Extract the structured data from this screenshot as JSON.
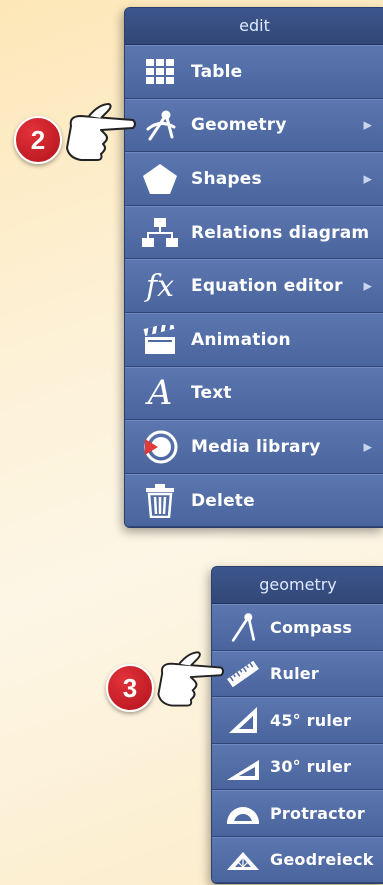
{
  "edit_menu": {
    "title": "edit",
    "items": [
      {
        "label": "Table",
        "icon": "table-icon",
        "submenu": false
      },
      {
        "label": "Geometry",
        "icon": "compass-icon",
        "submenu": true
      },
      {
        "label": "Shapes",
        "icon": "pentagon-icon",
        "submenu": true
      },
      {
        "label": "Relations diagram",
        "icon": "org-chart-icon",
        "submenu": false
      },
      {
        "label": "Equation editor",
        "icon": "fx-icon",
        "submenu": true
      },
      {
        "label": "Animation",
        "icon": "clapperboard-icon",
        "submenu": false
      },
      {
        "label": "Text",
        "icon": "letter-a-icon",
        "submenu": false
      },
      {
        "label": "Media library",
        "icon": "media-library-icon",
        "submenu": true
      },
      {
        "label": "Delete",
        "icon": "trash-icon",
        "submenu": false
      }
    ]
  },
  "geometry_menu": {
    "title": "geometry",
    "items": [
      {
        "label": "Compass",
        "icon": "compass-icon"
      },
      {
        "label": "Ruler",
        "icon": "ruler-icon"
      },
      {
        "label": "45° ruler",
        "icon": "set-square-45-icon"
      },
      {
        "label": "30° ruler",
        "icon": "set-square-30-icon"
      },
      {
        "label": "Protractor",
        "icon": "protractor-icon"
      },
      {
        "label": "Geodreieck",
        "icon": "geodreieck-icon"
      }
    ]
  },
  "callouts": {
    "step_2": "2",
    "step_3": "3"
  },
  "colors": {
    "menu_bg": "#4f6aa3",
    "menu_header": "#314777",
    "badge_red": "#c8141e",
    "background": "#fdf1d6"
  }
}
